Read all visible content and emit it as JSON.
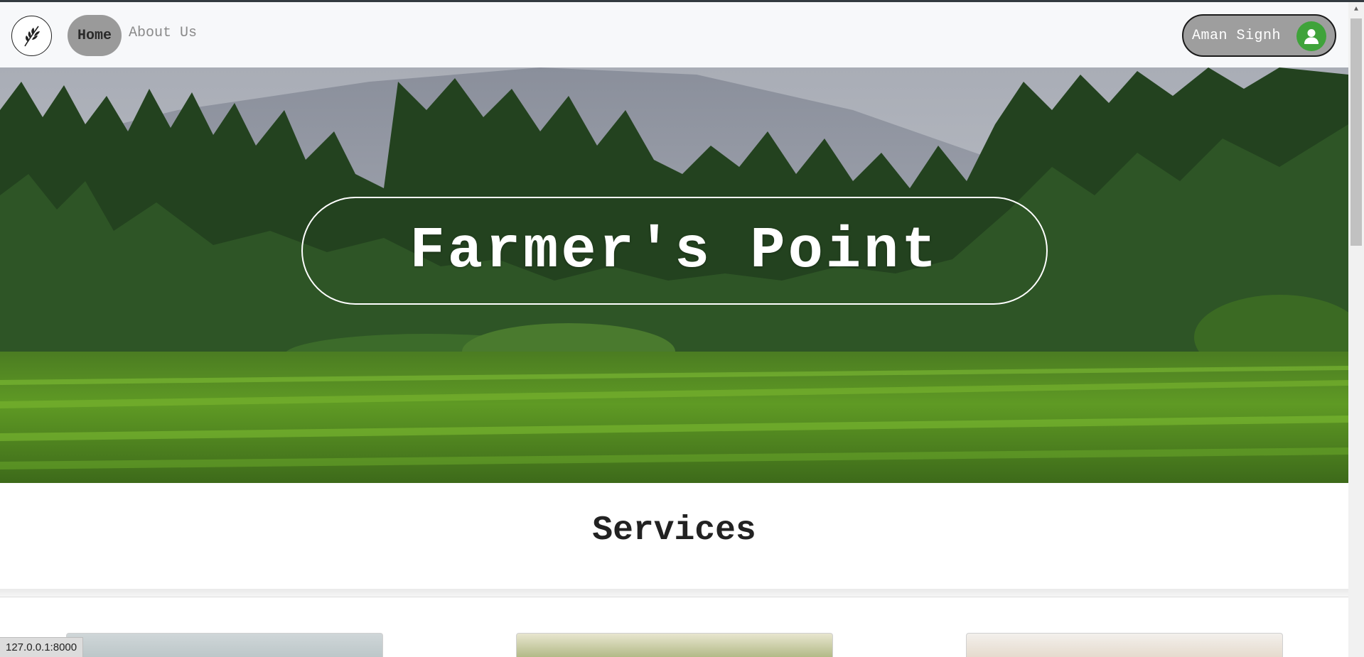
{
  "nav": {
    "logo_icon": "wheat-leaf-icon",
    "home_label": "Home",
    "about_label": "About Us",
    "user_name": "Aman Signh",
    "user_icon": "user-avatar-icon"
  },
  "hero": {
    "title": "Farmer's Point",
    "image": "green-rice-field-with-trees-and-mountains"
  },
  "services": {
    "title": "Services",
    "cards": [
      {
        "image": "service-card-image-1"
      },
      {
        "image": "service-card-image-2"
      },
      {
        "image": "service-card-image-3"
      }
    ]
  },
  "status": {
    "url": "127.0.0.1:8000"
  },
  "colors": {
    "nav_bg": "#f7f8fa",
    "home_pill": "#9a9a9a",
    "user_pill": "#9e9e9e",
    "avatar_green": "#3fa33a"
  }
}
